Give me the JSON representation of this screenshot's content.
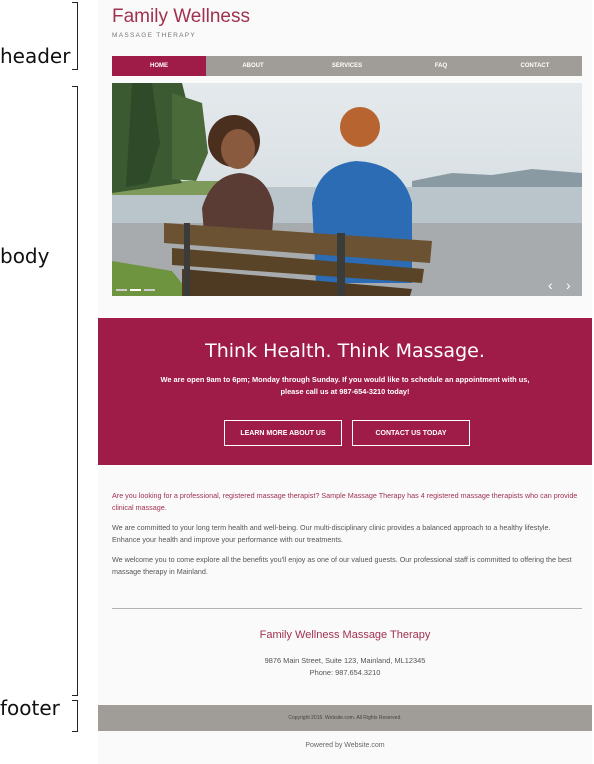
{
  "annotations": {
    "header": "header",
    "body": "body",
    "footer": "footer"
  },
  "site": {
    "name": "Family Wellness",
    "tagline": "MASSAGE THERAPY"
  },
  "nav": [
    {
      "label": "HOME",
      "active": true
    },
    {
      "label": "ABOUT",
      "active": false
    },
    {
      "label": "SERVICES",
      "active": false
    },
    {
      "label": "FAQ",
      "active": false
    },
    {
      "label": "CONTACT",
      "active": false
    }
  ],
  "hero": {
    "prev_arrow": "‹",
    "next_arrow": "›",
    "slide_count": 3,
    "active_slide": 2
  },
  "banner": {
    "title": "Think Health. Think Massage.",
    "text": "We are open 9am to 6pm; Monday through Sunday. If you would like to schedule an appointment with us, please call us at 987-654-3210 today!",
    "button_learn": "LEARN MORE ABOUT US",
    "button_contact": "CONTACT US TODAY"
  },
  "content": {
    "lead": "Are you looking for a professional, registered massage therapist? Sample Massage Therapy has 4 registered massage therapists who can provide clinical massage.",
    "p2": "We are committed to your long term health and well-being. Our multi-disciplinary clinic provides a balanced approach to a healthy lifestyle. Enhance your health and improve your performance with our treatments.",
    "p3": "We welcome you to come explore all the benefits you'll enjoy as one of our valued guests. Our professional staff is committed to offering the best massage therapy in Mainland."
  },
  "contact": {
    "business_name": "Family Wellness Massage Therapy",
    "address": "9876 Main Street, Suite 123, Mainland, ML12345",
    "phone": "Phone: 987.654.3210"
  },
  "footer": {
    "copyright": "Copyright 2016. Website.com. All Rights Reserved.",
    "powered": "Powered by Website.com"
  },
  "colors": {
    "brand": "#a01c48",
    "nav_bg": "#a09c97",
    "title_text": "#a0324f"
  }
}
